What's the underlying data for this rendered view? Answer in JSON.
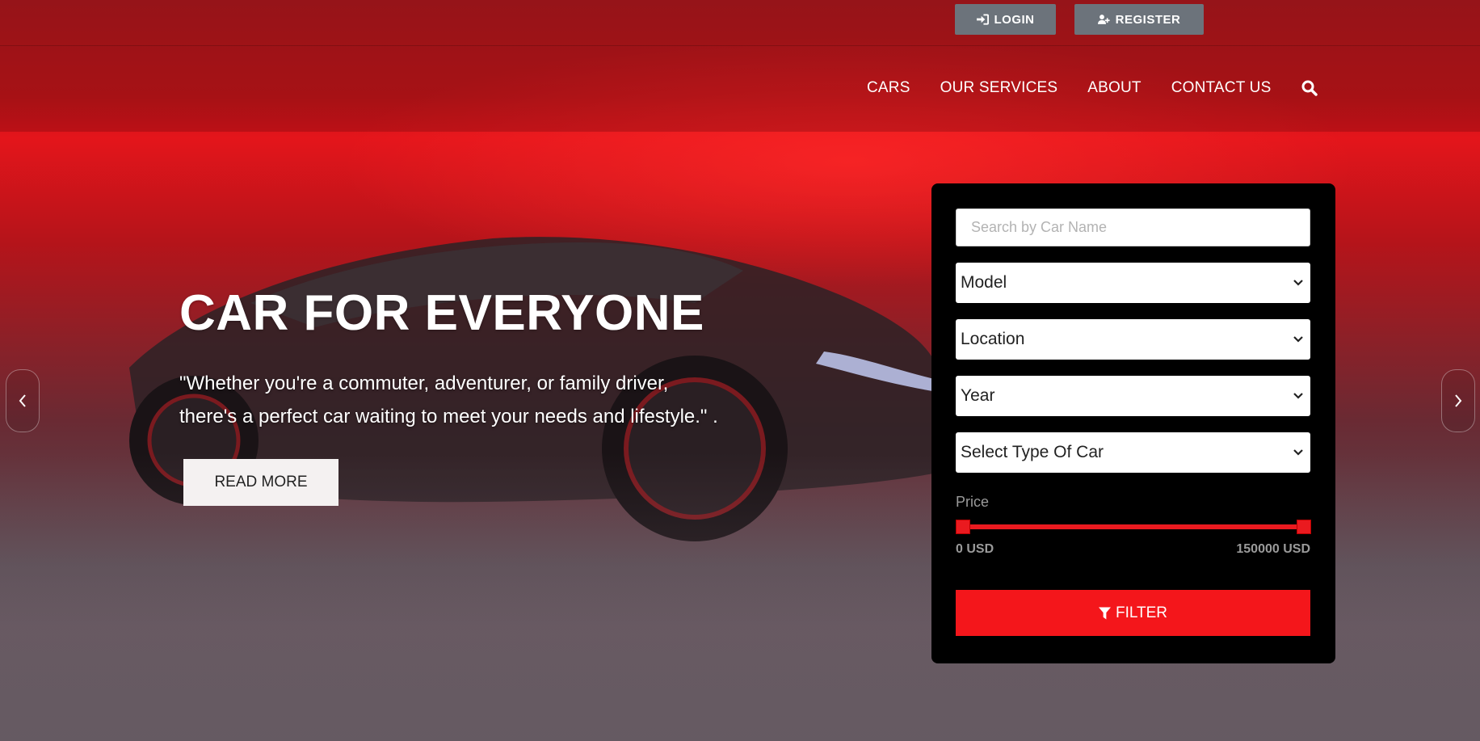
{
  "auth": {
    "login_label": "LOGIN",
    "register_label": "REGISTER"
  },
  "nav": {
    "items": [
      {
        "label": "CARS"
      },
      {
        "label": "OUR SERVICES"
      },
      {
        "label": "ABOUT"
      },
      {
        "label": "CONTACT US"
      }
    ],
    "search_icon": "search-icon"
  },
  "hero": {
    "title": "CAR FOR EVERYONE",
    "quote_line1": "\"Whether you're a commuter, adventurer, or family driver,",
    "quote_line2": "there's a perfect car waiting to meet your needs and lifestyle.\" .",
    "read_more_label": "READ MORE"
  },
  "filter": {
    "search_placeholder": "Search by Car Name",
    "model": "Model",
    "location": "Location",
    "year": "Year",
    "car_type": "Select Type Of Car",
    "price_label": "Price",
    "price_min": "0 USD",
    "price_max": "150000 USD",
    "price_range": [
      0,
      150000
    ],
    "filter_label": "FILTER"
  },
  "colors": {
    "accent": "#f4161b",
    "auth_button": "#6c737b",
    "panel": "#000000"
  }
}
